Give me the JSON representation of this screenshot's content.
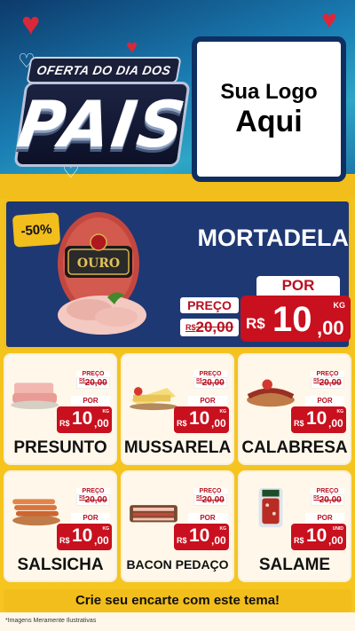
{
  "header": {
    "title_top": "OFERTA DO DIA DOS",
    "title_main": "PAIS",
    "logo_line1": "Sua Logo",
    "logo_line2": "Aqui"
  },
  "feature": {
    "discount": "-50%",
    "brand_text": "OURO",
    "name": "MORTADELA",
    "old_label": "PREÇO",
    "old_currency": "R$",
    "old_price": "20,00",
    "new_label": "POR",
    "new_currency": "R$",
    "new_int": "10",
    "new_dec": ",00",
    "unit": "KG"
  },
  "products": [
    {
      "name": "PRESUNTO",
      "old_label": "PREÇO",
      "old_currency": "R$",
      "old_price": "20,00",
      "new_label": "POR",
      "currency": "R$",
      "int": "10",
      "dec": ",00",
      "unit": "KG"
    },
    {
      "name": "MUSSARELA",
      "old_label": "PREÇO",
      "old_currency": "R$",
      "old_price": "20,00",
      "new_label": "POR",
      "currency": "R$",
      "int": "10",
      "dec": ",00",
      "unit": "KG"
    },
    {
      "name": "CALABRESA",
      "old_label": "PREÇO",
      "old_currency": "R$",
      "old_price": "20,00",
      "new_label": "POR",
      "currency": "R$",
      "int": "10",
      "dec": ",00",
      "unit": "KG"
    },
    {
      "name": "SALSICHA",
      "old_label": "PREÇO",
      "old_currency": "R$",
      "old_price": "20,00",
      "new_label": "POR",
      "currency": "R$",
      "int": "10",
      "dec": ",00",
      "unit": "KG"
    },
    {
      "name": "BACON PEDAÇO",
      "old_label": "PREÇO",
      "old_currency": "R$",
      "old_price": "20,00",
      "new_label": "POR",
      "currency": "R$",
      "int": "10",
      "dec": ",00",
      "unit": "KG"
    },
    {
      "name": "SALAME",
      "old_label": "PREÇO",
      "old_currency": "R$",
      "old_price": "20,00",
      "new_label": "POR",
      "currency": "R$",
      "int": "10",
      "dec": ",00",
      "unit": "UNID"
    }
  ],
  "cta": "Crie seu encarte com este tema!",
  "footnote": "*Imagens Meramente Ilustrativas",
  "colors": {
    "navy": "#1e3873",
    "red": "#c8101e",
    "yellow": "#f2be1c",
    "cream": "#fff8ea"
  }
}
